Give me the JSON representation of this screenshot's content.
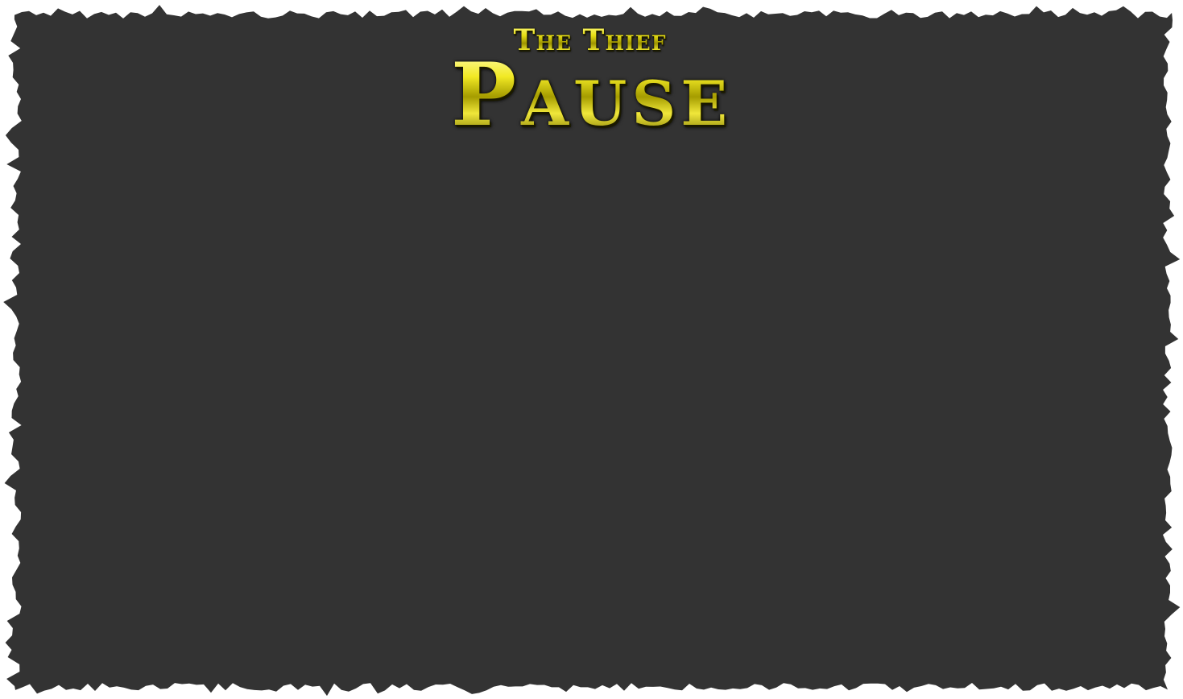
{
  "screen": {
    "name": "pause-menu",
    "background_color": "#ffffff",
    "panel_color": "#333333"
  },
  "header": {
    "subtitle": "The Thief",
    "title": "Pause",
    "text_color": "#d8cf10",
    "shadow_color": "#1a1900"
  }
}
